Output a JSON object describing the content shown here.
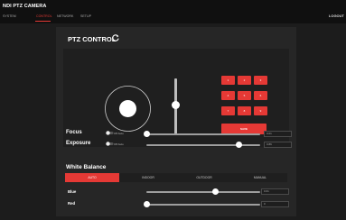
{
  "app": {
    "title": "NDI PTZ CAMERA",
    "logout": "LOGOUT"
  },
  "nav": {
    "items": [
      "SYSTEM",
      "CONTROL",
      "NETWORK",
      "SETUP"
    ],
    "active": "CONTROL"
  },
  "ptz": {
    "title": "PTZ CONTROL",
    "presets": [
      "1",
      "2",
      "3",
      "4",
      "5",
      "6",
      "7",
      "8",
      "9"
    ],
    "save_label": "SAVE",
    "zoom_level": 0.6
  },
  "focus": {
    "label": "Focus",
    "auto_text": "Off Auto",
    "auto": false,
    "value": "0.01",
    "slider_fraction": 0.01
  },
  "exposure": {
    "label": "Exposure",
    "auto_text": "Off Auto",
    "auto": false,
    "value": "0.86",
    "slider_fraction": 0.86
  },
  "white_balance": {
    "title": "White Balance",
    "tabs": [
      "AUTO",
      "INDOOR",
      "OUTDOOR",
      "MANUAL"
    ],
    "active_tab": "AUTO",
    "blue": {
      "label": "Blue",
      "value": "0.61",
      "slider_fraction": 0.61
    },
    "red": {
      "label": "Red",
      "value": "0",
      "slider_fraction": 0.0
    }
  },
  "colors": {
    "accent": "#e53935",
    "background": "#1c1c1c",
    "panel": "#262626"
  }
}
